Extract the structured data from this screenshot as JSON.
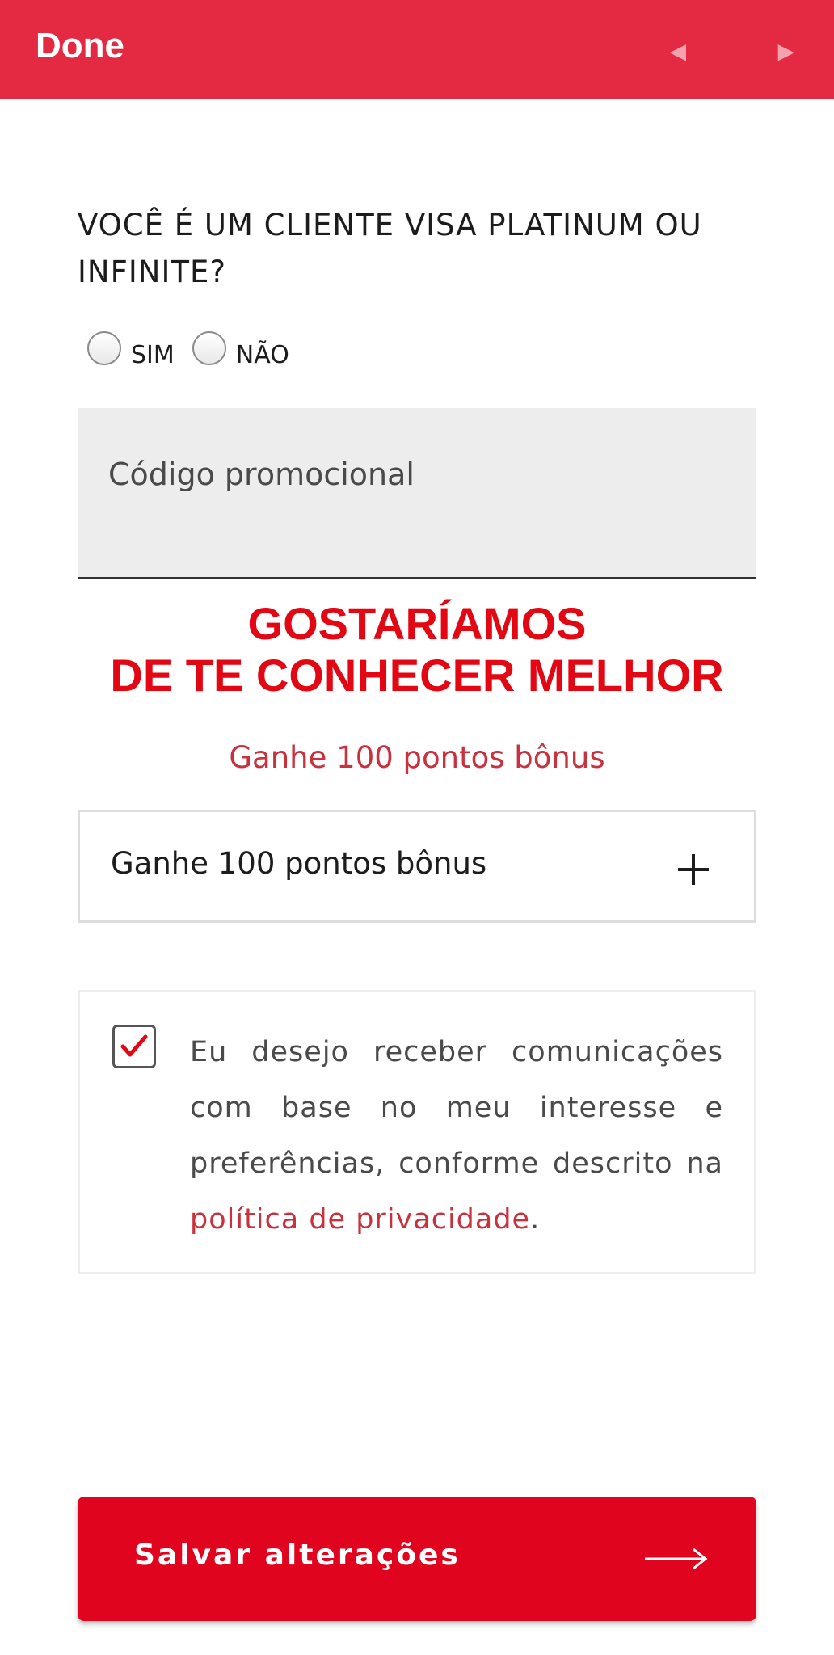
{
  "toolbar": {
    "done_label": "Done",
    "prev_icon": "◄",
    "next_icon": "►",
    "color": "#e32a42"
  },
  "form": {
    "question_line1": "VOCÊ É UM CLIENTE VISA PLATINUM OU",
    "question_line2": "INFINITE?",
    "radio_yes": "SIM",
    "radio_no": "NÃO",
    "promo_placeholder": "Código promocional"
  },
  "section": {
    "heading_line1": "GOSTARÍAMOS",
    "heading_line2": "DE TE CONHECER MELHOR",
    "subheading": "Ganhe 100 pontos bônus",
    "accordion_label": "Ganhe 100 pontos bônus",
    "accent_color": "#e30613"
  },
  "consent": {
    "checked": true,
    "text_before": "Eu desejo receber comunicações com base no meu interesse e preferências, conforme descrito na ",
    "link_text": "política de privacidade",
    "text_after": "."
  },
  "footer": {
    "save_label": "Salvar alterações",
    "button_color": "#e0041e"
  }
}
